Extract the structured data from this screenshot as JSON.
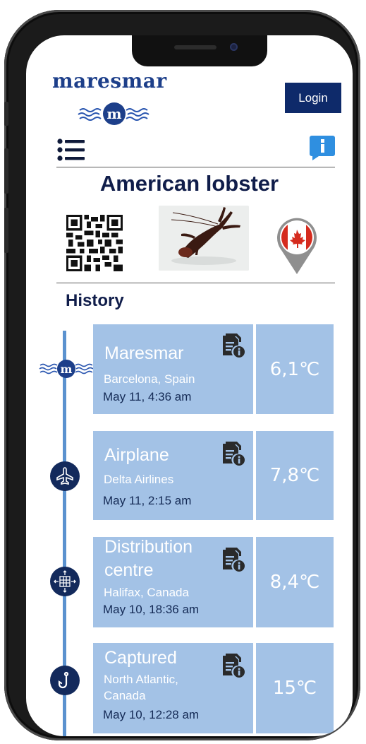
{
  "header": {
    "logo_text": "maresmar",
    "login_label": "Login"
  },
  "product": {
    "title": "American lobster",
    "origin_flag": "canada-flag-pin"
  },
  "history": {
    "heading": "History",
    "events": [
      {
        "icon": "maresmar-logo-icon",
        "name": "Maresmar",
        "place": "Barcelona, Spain",
        "time": "May 11, 4:36 am",
        "temperature": "6,1℃"
      },
      {
        "icon": "airplane-icon",
        "name": "Airplane",
        "place": "Delta Airlines",
        "time": "May 11, 2:15 am",
        "temperature": "7,8℃"
      },
      {
        "icon": "distribution-centre-icon",
        "name_line1": "Distribution",
        "name_line2": "centre",
        "place": "Halifax, Canada",
        "time": "May 10, 18:36 am",
        "temperature": "8,4℃"
      },
      {
        "icon": "fishing-hook-icon",
        "name": "Captured",
        "place_line1": "North Atlantic,",
        "place_line2": "Canada",
        "time": "May 10, 12:28 am",
        "temperature": "15℃"
      }
    ]
  },
  "colors": {
    "navy": "#0e2a6a",
    "card_blue": "#a3c2e6",
    "timeline_blue": "#5b92cf",
    "info_blue": "#2f8fe0"
  }
}
